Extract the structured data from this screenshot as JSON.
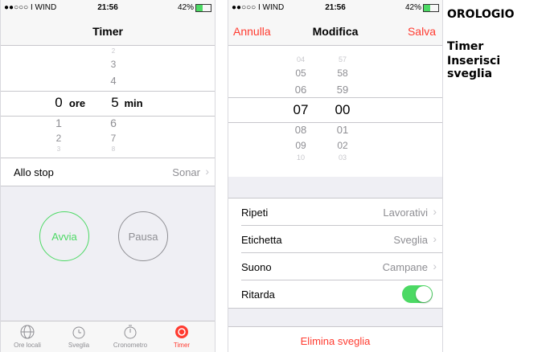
{
  "status": {
    "carrier": "●●○○○ I WIND",
    "wifi": "ᯤ",
    "time": "21:56",
    "icons": "⊕ ⏰ ∦",
    "battery": "42%"
  },
  "timer": {
    "title": "Timer",
    "hours": [
      "2",
      "3",
      "4",
      "0",
      "1",
      "2",
      "3"
    ],
    "hours_unit": "ore",
    "mins_above": [
      "2",
      "3",
      "4"
    ],
    "mins_sel": "5",
    "mins_unit": "min",
    "mins_below": [
      "6",
      "7",
      "8"
    ],
    "hours_sel": "0",
    "hours_below": [
      "1",
      "2",
      "3"
    ],
    "allo_stop_label": "Allo stop",
    "allo_stop_value": "Sonar",
    "start_label": "Avvia",
    "pause_label": "Pausa",
    "tabs": [
      "Ore locali",
      "Sveglia",
      "Cronometro",
      "Timer"
    ]
  },
  "alarm": {
    "cancel": "Annulla",
    "title": "Modifica",
    "save": "Salva",
    "hours_above": [
      "04",
      "05",
      "06"
    ],
    "hours_sel": "07",
    "hours_below": [
      "08",
      "09",
      "10"
    ],
    "mins_above": [
      "57",
      "58",
      "59"
    ],
    "mins_sel": "00",
    "mins_below": [
      "01",
      "02",
      "03"
    ],
    "rows": [
      {
        "label": "Ripeti",
        "value": "Lavorativi"
      },
      {
        "label": "Etichetta",
        "value": "Sveglia"
      },
      {
        "label": "Suono",
        "value": "Campane"
      },
      {
        "label": "Ritarda",
        "value": ""
      }
    ],
    "snooze_on": true,
    "delete": "Elimina sveglia"
  },
  "side": {
    "heading": "OROLOGIO",
    "line1": "Timer",
    "line2": "Inserisci sveglia"
  },
  "colors": {
    "accent": "#ff3b30",
    "green": "#4cd964",
    "gray": "#8e8e93"
  }
}
